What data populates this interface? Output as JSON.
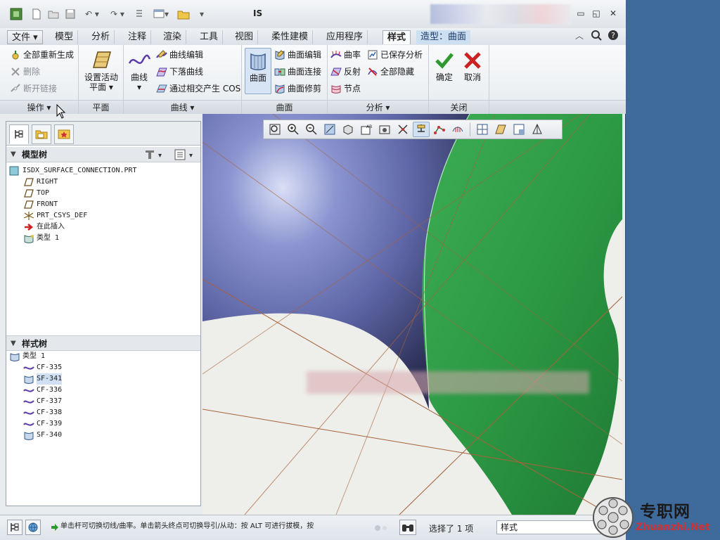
{
  "window": {
    "title": "IS"
  },
  "menu": {
    "file": "文件",
    "tabs": [
      "模型",
      "分析",
      "注释",
      "渲染",
      "工具",
      "视图",
      "柔性建模",
      "应用程序"
    ],
    "active_tab": "样式",
    "context_tab": "造型：曲面"
  },
  "ribbon": {
    "operations": {
      "regenerate_all": "全部重新生成",
      "delete": "删除",
      "break_link": "断开链接",
      "label": "操作"
    },
    "plane": {
      "set_active_line1": "设置活动",
      "set_active_line2": "平面",
      "label": "平面"
    },
    "curves": {
      "curve": "曲线",
      "curve_edit": "曲线编辑",
      "drop_curve": "下落曲线",
      "cos": "通过相交产生 COS",
      "label": "曲线"
    },
    "surface": {
      "surface": "曲面",
      "surface_edit": "曲面编辑",
      "surface_connect": "曲面连接",
      "surface_trim": "曲面修剪",
      "label": "曲面"
    },
    "analysis": {
      "curvature": "曲率",
      "saved_analysis": "已保存分析",
      "reflection": "反射",
      "hide_all": "全部隐藏",
      "nodes": "节点",
      "label": "分析"
    },
    "close": {
      "ok": "确定",
      "cancel": "取消",
      "label": "关闭"
    }
  },
  "model_tree": {
    "title": "模型树",
    "items": [
      "ISDX_SURFACE_CONNECTION.PRT",
      "RIGHT",
      "TOP",
      "FRONT",
      "PRT_CSYS_DEF",
      "在此插入",
      "类型 1"
    ]
  },
  "style_tree": {
    "title": "样式树",
    "root": "类型 1",
    "items": [
      "CF-335",
      "SF-341",
      "CF-336",
      "CF-337",
      "CF-338",
      "CF-339",
      "SF-340"
    ]
  },
  "status": {
    "message": "单击杆可切换切线/曲率。单击箭头终点可切换导引/从动：按 ALT 可进行拔模，按",
    "selected": "选择了 1 项",
    "filter": "样式"
  },
  "watermark": {
    "text": "专职网",
    "url": "Zhuanzhi.Net"
  },
  "colors": {
    "blue_surface": "#6872b4",
    "green_surface": "#2f9d47",
    "viewport_bg": "#eeeeea",
    "desktop": "#3f6a9c",
    "accent_ok": "#2c9a2c",
    "accent_cancel": "#cc2222"
  }
}
